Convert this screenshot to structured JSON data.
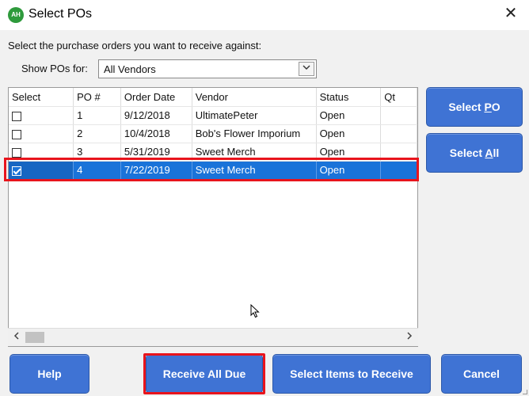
{
  "window": {
    "title": "Select POs",
    "icon_label": "AH"
  },
  "instruction": "Select the purchase orders you want to receive against:",
  "filter": {
    "label": "Show POs for:",
    "selected": "All Vendors"
  },
  "table": {
    "columns": [
      "Select",
      "PO #",
      "Order Date",
      "Vendor",
      "Status",
      "Qt"
    ],
    "rows": [
      {
        "checked": false,
        "po": "1",
        "date": "9/12/2018",
        "vendor": "UltimatePeter",
        "status": "Open"
      },
      {
        "checked": false,
        "po": "2",
        "date": "10/4/2018",
        "vendor": "Bob's Flower Imporium",
        "status": "Open"
      },
      {
        "checked": false,
        "po": "3",
        "date": "5/31/2019",
        "vendor": "Sweet Merch",
        "status": "Open"
      },
      {
        "checked": true,
        "po": "4",
        "date": "7/22/2019",
        "vendor": "Sweet Merch",
        "status": "Open"
      }
    ]
  },
  "buttons": {
    "select_po": "Select PO",
    "select_all": "Select All",
    "help": "Help",
    "receive_all_due": "Receive All Due",
    "select_items": "Select Items to Receive",
    "cancel": "Cancel"
  },
  "colors": {
    "button_blue": "#3f73d4",
    "selection_blue": "#1a73d9",
    "highlight_red": "#e8141c",
    "app_icon_green": "#2e9a3c"
  },
  "icons": {
    "close": "close-icon",
    "dropdown": "chevron-down-icon",
    "scroll_left": "chevron-left-icon",
    "scroll_right": "chevron-right-icon",
    "cursor": "mouse-pointer-icon"
  }
}
